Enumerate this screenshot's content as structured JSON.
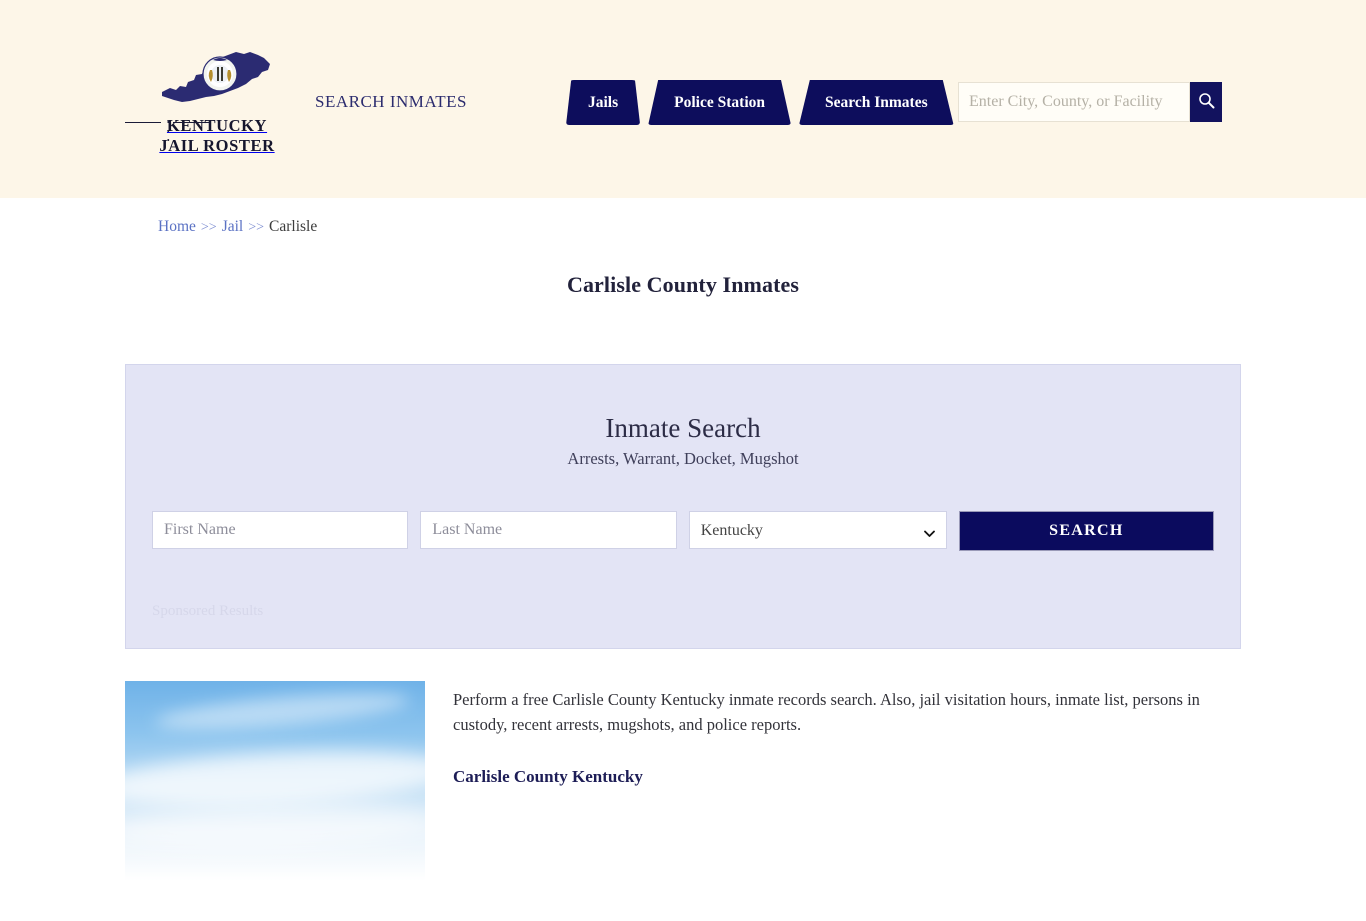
{
  "header": {
    "logo": {
      "line1": "KENTUCKY",
      "line2": "JAIL ROSTER",
      "divider_dots": "• • •",
      "map_color": "#2b2b72",
      "seal_color": "#f2f4ef"
    },
    "tagline": "SEARCH INMATES",
    "nav": [
      {
        "label": "Jails",
        "name": "nav-jails"
      },
      {
        "label": "Police Station",
        "name": "nav-police-station"
      },
      {
        "label": "Search Inmates",
        "name": "nav-search-inmates"
      }
    ],
    "search": {
      "placeholder": "Enter City, County, or Facility",
      "value": "",
      "button_icon": "search-icon"
    },
    "background_color": "#FDF6E8",
    "accent_color": "#0D0D5C"
  },
  "breadcrumb": {
    "home": "Home",
    "jail": "Jail",
    "separator": ">>",
    "current": "Carlisle"
  },
  "page": {
    "title": "Carlisle County Inmates"
  },
  "search_panel": {
    "title": "Inmate Search",
    "subtitle": "Arrests, Warrant, Docket, Mugshot",
    "first_name_placeholder": "First Name",
    "first_name_value": "",
    "last_name_placeholder": "Last Name",
    "last_name_value": "",
    "state_selected": "Kentucky",
    "state_options": [
      "Kentucky"
    ],
    "submit_label": "SEARCH",
    "sponsored_label": "Sponsored Results",
    "background_color": "#E3E4F5",
    "button_color": "#0B0B5E"
  },
  "content": {
    "thumbnail_alt": "sky-photo",
    "paragraph": "Perform a free Carlisle County Kentucky inmate records search. Also, jail visitation hours, inmate list, persons in custody, recent arrests, mugshots, and police reports.",
    "subheading": "Carlisle County Kentucky"
  }
}
